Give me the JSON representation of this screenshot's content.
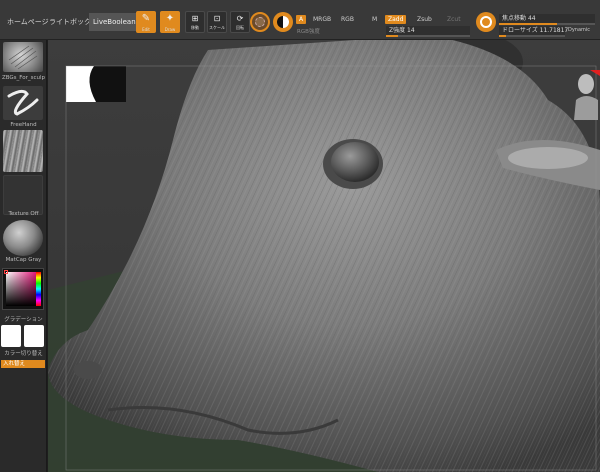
{
  "topbar": {
    "tabs": [
      {
        "label": "ホームページ"
      },
      {
        "label": "ライトボックス"
      },
      {
        "label": "LiveBoolean"
      }
    ],
    "tools": {
      "edit_label": "Edit",
      "draw_label": "Draw",
      "move_label": "移動",
      "scale_label": "スケール",
      "rotate_label": "回転"
    },
    "channels": {
      "a_label": "A",
      "mrgb_label": "MRGB",
      "rgb_label": "RGB",
      "m_label": "M",
      "zadd_label": "Zadd",
      "zsub_label": "Zsub",
      "zcut_label": "Zcut",
      "rgb_intensity_label": "RGB強度",
      "z_intensity_label": "Z強度",
      "z_intensity_value": "14"
    },
    "brush": {
      "focal_shift_label": "焦点移動",
      "focal_shift_value": "44",
      "draw_size_label": "ドローサイズ",
      "draw_size_value": "11.71817",
      "dynamic_label": "Dynamic"
    }
  },
  "leftpanel": {
    "brush_label": "ZBGs_For_sculp",
    "stroke_label": "FreeHand",
    "alpha_label": "",
    "texture_label": "Texture Off",
    "material_label": "MatCap Gray",
    "gradient_label": "グラデーション",
    "color_switch_label": "カラー切り替え",
    "swap_label": "入れ替え"
  },
  "colors": {
    "accent": "#e08a1e",
    "panel": "#2a2a2a",
    "topbar": "#393939"
  },
  "icons": {
    "edit": "edit-pencil-icon",
    "draw": "draw-icon",
    "move": "move-icon",
    "scale": "scale-icon",
    "rotate": "rotate-icon",
    "sphere": "sphere-icon",
    "gizmo": "gizmo-icon"
  }
}
